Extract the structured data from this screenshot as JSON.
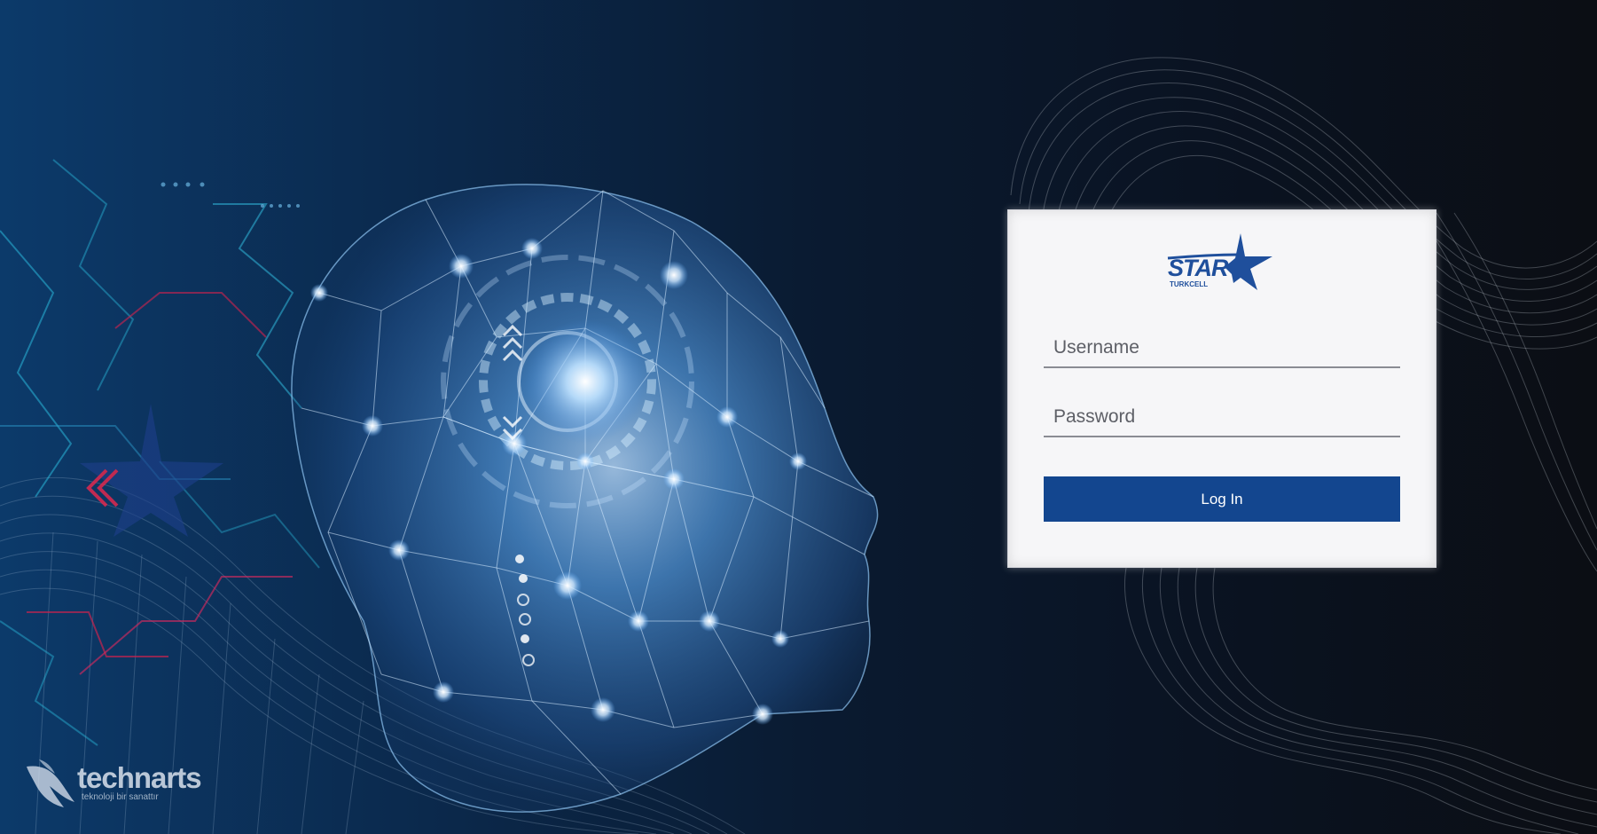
{
  "login": {
    "logo_label": "STAR",
    "logo_sub": "TURKCELL",
    "username_placeholder": "Username",
    "password_placeholder": "Password",
    "login_label": "Log In"
  },
  "footer": {
    "logo_name": "technarts",
    "tagline": "teknoloji bir sanattır"
  },
  "colors": {
    "button": "#13468f",
    "brand_blue": "#1f4f9c",
    "card_bg": "#f6f6f8"
  },
  "icons": [
    "star-logo-icon",
    "bird-logo-icon",
    "ai-head-graphic",
    "wave-mesh-graphic"
  ]
}
